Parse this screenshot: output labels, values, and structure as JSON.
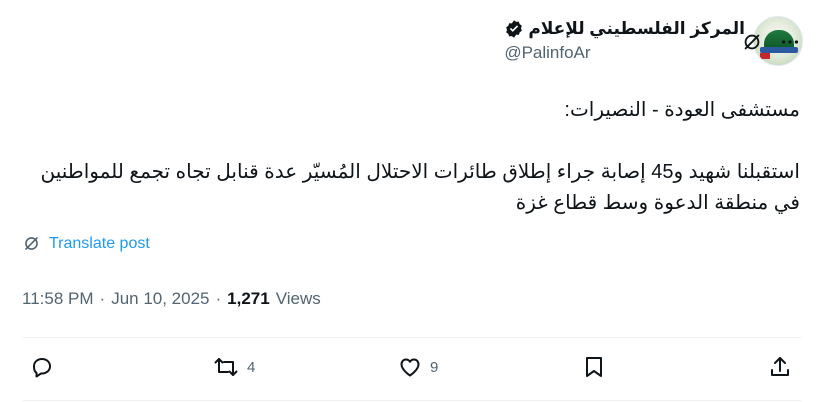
{
  "author": {
    "display_name": "المركز الفلسطيني للإعلام",
    "handle": "@PalinfoAr"
  },
  "post": {
    "text": "مستشفى العودة - النصيرات:\n\nاستقبلنا شهيد و45 إصابة جراء إطلاق طائرات الاحتلال المُسيّر عدة قنابل تجاه تجمع للمواطنين في منطقة الدعوة وسط قطاع غزة",
    "translate_label": "Translate post",
    "time": "11:58 PM",
    "date": "Jun 10, 2025",
    "views_count": "1,271",
    "views_label": "Views",
    "separator": "·"
  },
  "actions": {
    "reposts": "4",
    "likes": "9"
  },
  "icons": {
    "verified": "verified-badge-icon",
    "grok": "grok-icon",
    "more": "more-icon",
    "reply": "reply-icon",
    "repost": "repost-icon",
    "like": "like-icon",
    "bookmark": "bookmark-icon",
    "share": "share-icon",
    "translate": "translate-icon"
  },
  "colors": {
    "text": "#0f1419",
    "secondary": "#536471",
    "link": "#1d9bf0",
    "divider": "#eff3f4"
  }
}
